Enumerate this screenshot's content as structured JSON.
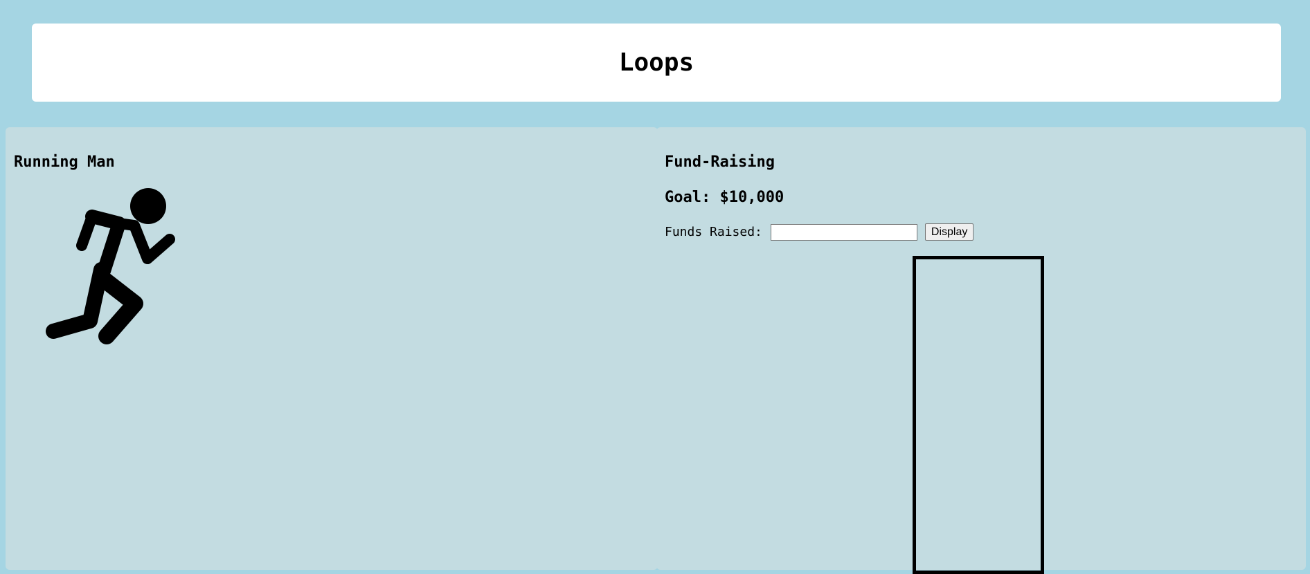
{
  "header": {
    "title": "Loops"
  },
  "left_panel": {
    "title": "Running Man",
    "image_icon": "running-man-icon"
  },
  "right_panel": {
    "title": "Fund-Raising",
    "goal_text": "Goal: $10,000",
    "funds_label": "Funds Raised:",
    "funds_value": "",
    "display_label": "Display",
    "progress_fraction": 0
  },
  "colors": {
    "page_background": "#a5d5e3",
    "panel_background": "#c3dce1",
    "header_background": "#ffffff"
  }
}
